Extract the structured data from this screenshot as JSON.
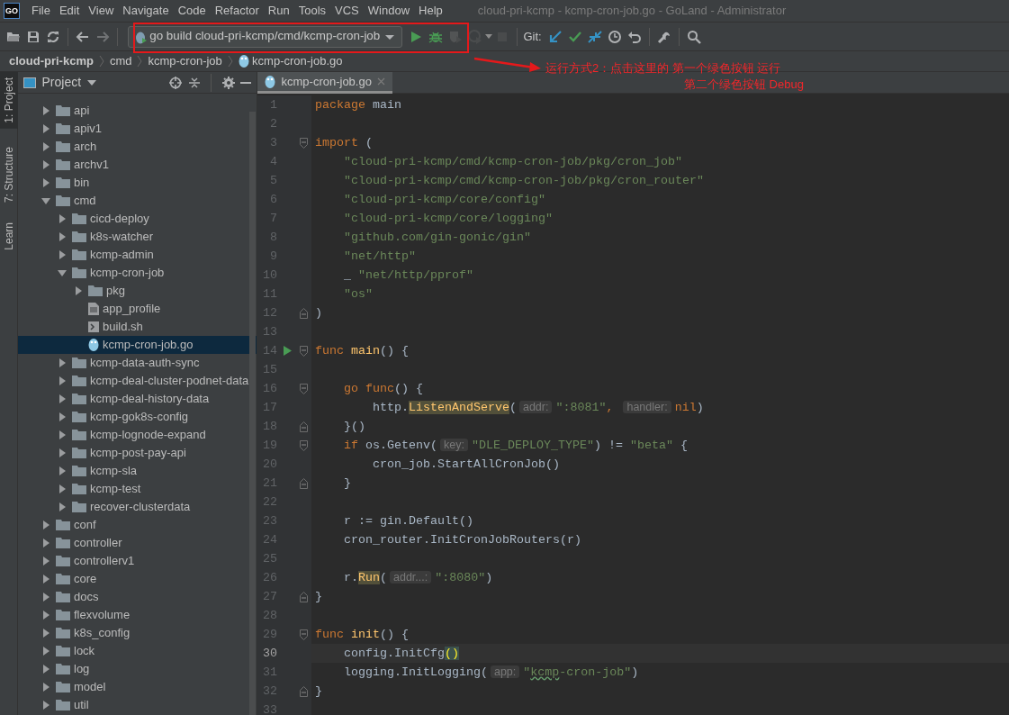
{
  "window": {
    "logo": "GO",
    "title": "cloud-pri-kcmp - kcmp-cron-job.go - GoLand - Administrator"
  },
  "menu": [
    "File",
    "Edit",
    "View",
    "Navigate",
    "Code",
    "Refactor",
    "Run",
    "Tools",
    "VCS",
    "Window",
    "Help"
  ],
  "toolbar": [
    {
      "kind": "open",
      "disabled": false
    },
    {
      "kind": "save",
      "disabled": false
    },
    {
      "kind": "sync",
      "disabled": false
    },
    {
      "kind": "separator"
    },
    {
      "kind": "back",
      "disabled": false
    },
    {
      "kind": "forward",
      "disabled": true
    },
    {
      "kind": "separator"
    },
    {
      "kind": "run-config",
      "label": "go build cloud-pri-kcmp/cmd/kcmp-cron-job"
    },
    {
      "kind": "run",
      "disabled": false
    },
    {
      "kind": "debug",
      "disabled": false
    },
    {
      "kind": "coverage",
      "disabled": true
    },
    {
      "kind": "profile",
      "disabled": true
    },
    {
      "kind": "stop",
      "disabled": true
    },
    {
      "kind": "separator"
    },
    {
      "kind": "label",
      "text": "Git:"
    },
    {
      "kind": "update",
      "disabled": false
    },
    {
      "kind": "commit",
      "disabled": false
    },
    {
      "kind": "compare",
      "disabled": false
    },
    {
      "kind": "history",
      "disabled": false
    },
    {
      "kind": "revert",
      "disabled": false
    },
    {
      "kind": "separator"
    },
    {
      "kind": "settings",
      "disabled": false
    },
    {
      "kind": "separator"
    },
    {
      "kind": "search",
      "disabled": false
    }
  ],
  "breadcrumbs": [
    {
      "label": "cloud-pri-kcmp",
      "kind": "project"
    },
    {
      "label": "cmd",
      "kind": "folder"
    },
    {
      "label": "kcmp-cron-job",
      "kind": "folder"
    },
    {
      "label": "kcmp-cron-job.go",
      "kind": "file-go"
    }
  ],
  "side_tabs": [
    {
      "label": "1: Project",
      "kind": "project",
      "selected": true
    },
    {
      "label": "7: Structure",
      "kind": "structure",
      "selected": false
    },
    {
      "label": "Learn",
      "kind": "learn",
      "selected": false
    }
  ],
  "project_panel": {
    "title": "Project",
    "tree": [
      {
        "label": "api",
        "kind": "folder",
        "expanded": false,
        "selected": false
      },
      {
        "label": "apiv1",
        "kind": "folder",
        "expanded": false,
        "selected": false
      },
      {
        "label": "arch",
        "kind": "folder",
        "expanded": false,
        "selected": false
      },
      {
        "label": "archv1",
        "kind": "folder",
        "expanded": false,
        "selected": false
      },
      {
        "label": "bin",
        "kind": "folder",
        "expanded": false,
        "selected": false
      },
      {
        "label": "cmd",
        "kind": "folder",
        "expanded": true,
        "selected": false,
        "children": [
          {
            "label": "cicd-deploy",
            "kind": "folder",
            "expanded": false,
            "selected": false
          },
          {
            "label": "k8s-watcher",
            "kind": "folder",
            "expanded": false,
            "selected": false
          },
          {
            "label": "kcmp-admin",
            "kind": "folder",
            "expanded": false,
            "selected": false
          },
          {
            "label": "kcmp-cron-job",
            "kind": "folder",
            "expanded": true,
            "selected": false,
            "children": [
              {
                "label": "pkg",
                "kind": "folder",
                "expanded": false,
                "selected": false
              },
              {
                "label": "app_profile",
                "kind": "file-text",
                "selected": false
              },
              {
                "label": "build.sh",
                "kind": "file-shell",
                "selected": false
              },
              {
                "label": "kcmp-cron-job.go",
                "kind": "file-go",
                "selected": true
              }
            ]
          },
          {
            "label": "kcmp-data-auth-sync",
            "kind": "folder",
            "expanded": false,
            "selected": false
          },
          {
            "label": "kcmp-deal-cluster-podnet-data",
            "kind": "folder",
            "expanded": false,
            "selected": false
          },
          {
            "label": "kcmp-deal-history-data",
            "kind": "folder",
            "expanded": false,
            "selected": false
          },
          {
            "label": "kcmp-gok8s-config",
            "kind": "folder",
            "expanded": false,
            "selected": false
          },
          {
            "label": "kcmp-lognode-expand",
            "kind": "folder",
            "expanded": false,
            "selected": false
          },
          {
            "label": "kcmp-post-pay-api",
            "kind": "folder",
            "expanded": false,
            "selected": false
          },
          {
            "label": "kcmp-sla",
            "kind": "folder",
            "expanded": false,
            "selected": false
          },
          {
            "label": "kcmp-test",
            "kind": "folder",
            "expanded": false,
            "selected": false
          },
          {
            "label": "recover-clusterdata",
            "kind": "folder",
            "expanded": false,
            "selected": false
          }
        ]
      },
      {
        "label": "conf",
        "kind": "folder",
        "expanded": false,
        "selected": false
      },
      {
        "label": "controller",
        "kind": "folder",
        "expanded": false,
        "selected": false
      },
      {
        "label": "controllerv1",
        "kind": "folder",
        "expanded": false,
        "selected": false
      },
      {
        "label": "core",
        "kind": "folder",
        "expanded": false,
        "selected": false
      },
      {
        "label": "docs",
        "kind": "folder",
        "expanded": false,
        "selected": false
      },
      {
        "label": "flexvolume",
        "kind": "folder",
        "expanded": false,
        "selected": false
      },
      {
        "label": "k8s_config",
        "kind": "folder",
        "expanded": false,
        "selected": false
      },
      {
        "label": "lock",
        "kind": "folder",
        "expanded": false,
        "selected": false
      },
      {
        "label": "log",
        "kind": "folder",
        "expanded": false,
        "selected": false
      },
      {
        "label": "model",
        "kind": "folder",
        "expanded": false,
        "selected": false
      },
      {
        "label": "util",
        "kind": "folder",
        "expanded": false,
        "selected": false
      }
    ]
  },
  "editor": {
    "tabs": [
      {
        "label": "kcmp-cron-job.go",
        "selected": true
      }
    ],
    "lines": [
      {
        "number": "1",
        "kind": "plain",
        "current": false,
        "tokens": [
          {
            "kind": "keyword",
            "text": "package"
          },
          {
            "kind": "plain",
            "text": " main"
          }
        ]
      },
      {
        "number": "2",
        "kind": "plain",
        "current": false
      },
      {
        "number": "3",
        "kind": "fold-start",
        "current": false,
        "tokens": [
          {
            "kind": "keyword",
            "text": "import"
          },
          {
            "kind": "plain",
            "text": " ("
          }
        ]
      },
      {
        "number": "4",
        "kind": "plain",
        "current": false,
        "tokens": [
          {
            "kind": "string",
            "text": "    \"cloud-pri-kcmp/cmd/kcmp-cron-job/pkg/cron_job\""
          }
        ]
      },
      {
        "number": "5",
        "kind": "plain",
        "current": false,
        "tokens": [
          {
            "kind": "string",
            "text": "    \"cloud-pri-kcmp/cmd/kcmp-cron-job/pkg/cron_router\""
          }
        ]
      },
      {
        "number": "6",
        "kind": "plain",
        "current": false,
        "tokens": [
          {
            "kind": "string",
            "text": "    \"cloud-pri-kcmp/core/config\""
          }
        ]
      },
      {
        "number": "7",
        "kind": "plain",
        "current": false,
        "tokens": [
          {
            "kind": "string",
            "text": "    \"cloud-pri-kcmp/core/logging\""
          }
        ]
      },
      {
        "number": "8",
        "kind": "plain",
        "current": false,
        "tokens": [
          {
            "kind": "string",
            "text": "    \"github.com/gin-gonic/gin\""
          }
        ]
      },
      {
        "number": "9",
        "kind": "plain",
        "current": false,
        "tokens": [
          {
            "kind": "string",
            "text": "    \"net/http\""
          }
        ]
      },
      {
        "number": "10",
        "kind": "plain",
        "current": false,
        "tokens": [
          {
            "kind": "plain",
            "text": "    _ "
          },
          {
            "kind": "string",
            "text": "\"net/http/pprof\""
          }
        ]
      },
      {
        "number": "11",
        "kind": "plain",
        "current": false,
        "tokens": [
          {
            "kind": "string",
            "text": "    \"os\""
          }
        ]
      },
      {
        "number": "12",
        "kind": "fold-end",
        "current": false,
        "tokens": [
          {
            "kind": "plain",
            "text": ")"
          }
        ]
      },
      {
        "number": "13",
        "kind": "plain",
        "current": false
      },
      {
        "number": "14",
        "kind": "fold-start",
        "current": false,
        "run_marker": true,
        "tokens": [
          {
            "kind": "keyword",
            "text": "func "
          },
          {
            "kind": "function",
            "text": "main"
          },
          {
            "kind": "plain",
            "text": "() {"
          }
        ]
      },
      {
        "number": "15",
        "kind": "plain",
        "current": false
      },
      {
        "number": "16",
        "kind": "fold-start",
        "current": false,
        "tokens": [
          {
            "kind": "keyword",
            "text": "    go func"
          },
          {
            "kind": "plain",
            "text": "() {"
          }
        ]
      },
      {
        "number": "17",
        "kind": "plain",
        "current": false,
        "tokens": [
          {
            "kind": "plain",
            "text": "        http."
          },
          {
            "kind": "usage",
            "text": "ListenAndServe"
          },
          {
            "kind": "plain",
            "text": "("
          },
          {
            "kind": "hint",
            "text": "addr:"
          },
          {
            "kind": "string",
            "text": "\":8081\""
          },
          {
            "kind": "keyword",
            "text": ", "
          },
          {
            "kind": "hint",
            "text": "handler:"
          },
          {
            "kind": "keyword",
            "text": "nil"
          },
          {
            "kind": "plain",
            "text": ")"
          }
        ]
      },
      {
        "number": "18",
        "kind": "fold-end",
        "current": false,
        "tokens": [
          {
            "kind": "plain",
            "text": "    }()"
          }
        ]
      },
      {
        "number": "19",
        "kind": "fold-start",
        "current": false,
        "tokens": [
          {
            "kind": "keyword",
            "text": "    if"
          },
          {
            "kind": "plain",
            "text": " os.Getenv("
          },
          {
            "kind": "hint",
            "text": "key:"
          },
          {
            "kind": "string",
            "text": "\"DLE_DEPLOY_TYPE\""
          },
          {
            "kind": "plain",
            "text": ") != "
          },
          {
            "kind": "string",
            "text": "\"beta\""
          },
          {
            "kind": "plain",
            "text": " {"
          }
        ]
      },
      {
        "number": "20",
        "kind": "plain",
        "current": false,
        "tokens": [
          {
            "kind": "plain",
            "text": "        cron_job.StartAllCronJob()"
          }
        ]
      },
      {
        "number": "21",
        "kind": "fold-end",
        "current": false,
        "tokens": [
          {
            "kind": "plain",
            "text": "    }"
          }
        ]
      },
      {
        "number": "22",
        "kind": "plain",
        "current": false
      },
      {
        "number": "23",
        "kind": "plain",
        "current": false,
        "tokens": [
          {
            "kind": "plain",
            "text": "    r := gin.Default()"
          }
        ]
      },
      {
        "number": "24",
        "kind": "plain",
        "current": false,
        "tokens": [
          {
            "kind": "plain",
            "text": "    cron_router.InitCronJobRouters(r)"
          }
        ]
      },
      {
        "number": "25",
        "kind": "plain",
        "current": false
      },
      {
        "number": "26",
        "kind": "plain",
        "current": false,
        "tokens": [
          {
            "kind": "plain",
            "text": "    r."
          },
          {
            "kind": "usage",
            "text": "Run"
          },
          {
            "kind": "plain",
            "text": "("
          },
          {
            "kind": "hint",
            "text": "addr...:"
          },
          {
            "kind": "string",
            "text": "\":8080\""
          },
          {
            "kind": "plain",
            "text": ")"
          }
        ]
      },
      {
        "number": "27",
        "kind": "fold-end",
        "current": false,
        "tokens": [
          {
            "kind": "plain",
            "text": "}"
          }
        ]
      },
      {
        "number": "28",
        "kind": "plain",
        "current": false
      },
      {
        "number": "29",
        "kind": "fold-start",
        "current": false,
        "tokens": [
          {
            "kind": "keyword",
            "text": "func "
          },
          {
            "kind": "function",
            "text": "init"
          },
          {
            "kind": "plain",
            "text": "() {"
          }
        ]
      },
      {
        "number": "30",
        "kind": "plain",
        "current": true,
        "tokens": [
          {
            "kind": "plain",
            "text": "    config.InitCfg"
          },
          {
            "kind": "brace-match",
            "text": "()"
          }
        ]
      },
      {
        "number": "31",
        "kind": "plain",
        "current": false,
        "tokens": [
          {
            "kind": "plain",
            "text": "    logging.InitLogging("
          },
          {
            "kind": "hint",
            "text": "app:"
          },
          {
            "kind": "string",
            "text": "\""
          },
          {
            "kind": "typo",
            "text": "kcmp"
          },
          {
            "kind": "string",
            "text": "-cron-job\""
          },
          {
            "kind": "plain",
            "text": ")"
          }
        ]
      },
      {
        "number": "32",
        "kind": "fold-end",
        "current": false,
        "tokens": [
          {
            "kind": "plain",
            "text": "}"
          }
        ]
      },
      {
        "number": "33",
        "kind": "plain",
        "current": false
      }
    ]
  },
  "annotation": {
    "lines": [
      "运行方式2：点击这里的 第一个绿色按钮  运行",
      "第二个绿色按钮  Debug"
    ]
  }
}
